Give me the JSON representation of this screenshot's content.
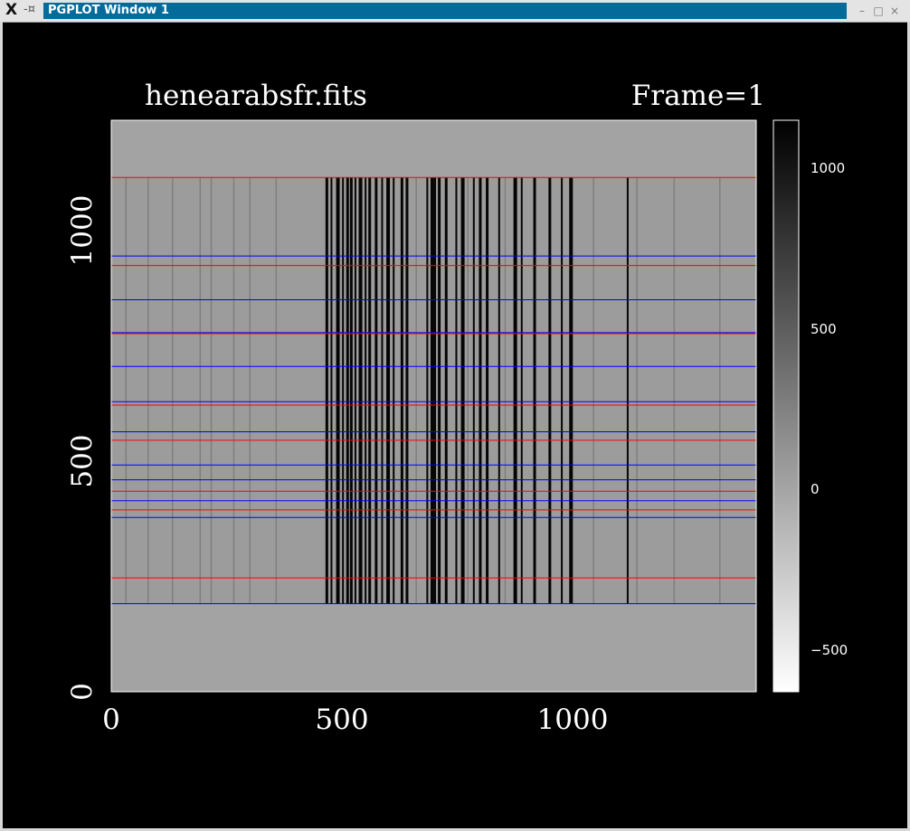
{
  "window": {
    "close_glyph": "X",
    "pin_glyph": "-¤",
    "title": "PGPLOT Window 1",
    "minimize_glyph": "–",
    "maximize_glyph": "□",
    "close_button_glyph": "×"
  },
  "plot": {
    "title_left": "henearabsfr.fits",
    "title_right": "Frame=1",
    "x_ticks": [
      "0",
      "500",
      "1000"
    ],
    "y_ticks": [
      "0",
      "500",
      "1000"
    ],
    "colorbar_ticks": [
      "1000",
      "500",
      "0",
      "−500"
    ],
    "colors": {
      "image_background": "#a3a3a3",
      "red_trace": "#ff0000",
      "blue_trace": "#0000ff",
      "text": "#ffffff"
    }
  },
  "chart_data": {
    "type": "heatmap",
    "title": "henearabsfr.fits",
    "subtitle": "Frame=1",
    "xlim": [
      0,
      1400
    ],
    "ylim": [
      0,
      1200
    ],
    "colorbar_range": [
      -650,
      1150
    ],
    "red_lines_y": [
      1080,
      895,
      752,
      602,
      528,
      421,
      382,
      239
    ],
    "blue_lines_y": [
      915,
      823,
      754,
      683,
      609,
      546,
      476,
      445,
      401,
      366,
      185
    ],
    "emission_lines_x": [
      468,
      478,
      492,
      503,
      513,
      521,
      530,
      541,
      552,
      561,
      575,
      588,
      601,
      613,
      631,
      642,
      686,
      697,
      703,
      712,
      727,
      749,
      763,
      787,
      801,
      816,
      842,
      877,
      891,
      919,
      952,
      978,
      998,
      1121
    ],
    "faint_lines_x": [
      32,
      80,
      133,
      193,
      217,
      266,
      301,
      358,
      662,
      774,
      855,
      1047,
      1141,
      1222,
      1321
    ]
  }
}
